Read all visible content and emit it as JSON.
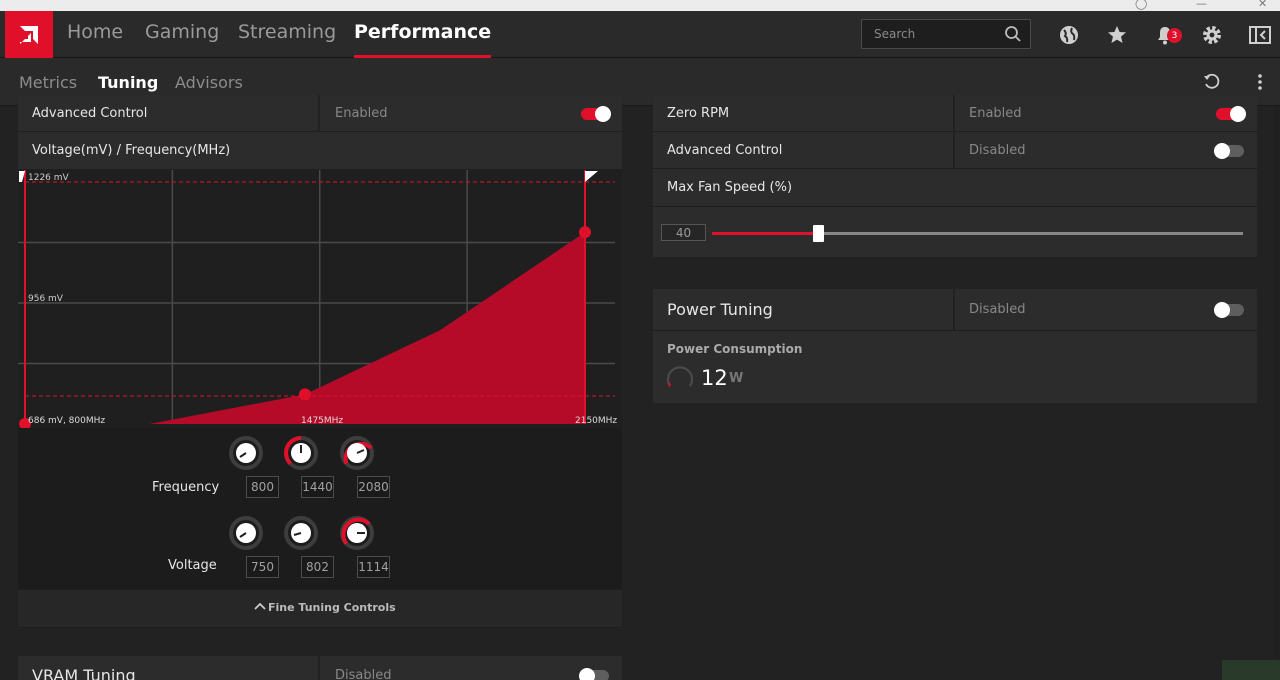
{
  "nav": {
    "tabs": [
      {
        "label": "Home"
      },
      {
        "label": "Gaming"
      },
      {
        "label": "Streaming"
      },
      {
        "label": "Performance"
      }
    ],
    "search_placeholder": "Search",
    "notification_count": "3"
  },
  "subnav": {
    "tabs": [
      {
        "label": "Metrics"
      },
      {
        "label": "Tuning"
      },
      {
        "label": "Advisors"
      }
    ]
  },
  "left": {
    "advanced_control": {
      "label": "Advanced Control",
      "state": "Enabled",
      "on": true
    },
    "vf_title": "Voltage(mV) / Frequency(MHz)",
    "chart_labels": {
      "top_left": "1226 mV",
      "mid_left": "956 mV",
      "bottom_left": "686 mV, 800MHz",
      "bottom_mid": "1475MHz",
      "bottom_right": "2150MHz"
    },
    "frequency": {
      "label": "Frequency",
      "values": [
        "800",
        "1440",
        "2080"
      ]
    },
    "voltage": {
      "label": "Voltage",
      "values": [
        "750",
        "802",
        "1114"
      ]
    },
    "fine_tuning": "Fine Tuning Controls",
    "vram": {
      "label": "VRAM Tuning",
      "state": "Disabled",
      "on": false
    }
  },
  "right": {
    "zero_rpm": {
      "label": "Zero RPM",
      "state": "Enabled",
      "on": true
    },
    "advanced_control": {
      "label": "Advanced Control",
      "state": "Disabled",
      "on": false
    },
    "max_fan": {
      "label": "Max Fan Speed (%)",
      "value": "40",
      "fraction": 0.2
    },
    "power_tuning": {
      "label": "Power Tuning",
      "state": "Disabled",
      "on": false
    },
    "power_consumption": {
      "label": "Power Consumption",
      "value": "12",
      "unit": "W"
    }
  },
  "chart_data": {
    "type": "area",
    "title": "Voltage(mV) / Frequency(MHz)",
    "x": [
      800,
      1100,
      1475,
      1800,
      2150
    ],
    "series": [
      {
        "values": [
          686,
          686,
          752,
          895,
          1114
        ]
      }
    ],
    "control_points": [
      {
        "x": 800,
        "y": 686
      },
      {
        "x": 1475,
        "y": 752
      },
      {
        "x": 2150,
        "y": 1114
      }
    ],
    "xlim": [
      800,
      2150
    ],
    "ylim": [
      686,
      1226
    ],
    "x_labels": [
      "800MHz",
      "1475MHz",
      "2150MHz"
    ],
    "y_labels": [
      "1226 mV",
      "956 mV",
      "686 mV"
    ],
    "grid": true,
    "colors": {
      "fill": "#b50a28",
      "line": "#e0102b",
      "point": "#e0102b"
    }
  },
  "colors": {
    "accent": "#e0102b",
    "panel": "#2c2c2c",
    "bg": "#222222"
  }
}
